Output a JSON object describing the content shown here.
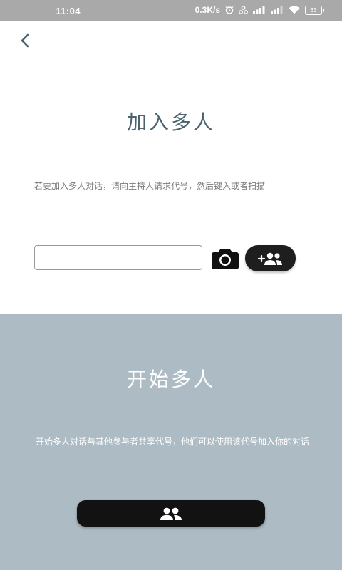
{
  "status_bar": {
    "time": "11:04",
    "network_speed": "0.3K/s",
    "battery": "63",
    "icons": [
      "alarm-icon",
      "share-icon",
      "signal-icon",
      "signal-icon",
      "wifi-icon",
      "battery-icon"
    ]
  },
  "header": {
    "back_icon": "chevron-left-icon"
  },
  "join": {
    "title": "加入多人",
    "description": "若要加入多人对话，请向主持人请求代号，然后键入或者扫描",
    "code_input_value": "",
    "code_input_placeholder": "",
    "camera_icon": "camera-icon",
    "join_icon": "add-group-icon"
  },
  "start": {
    "title": "开始多人",
    "description": "开始多人对话与其他参与者共享代号，他们可以使用该代号加入你的对话",
    "button_icon": "group-icon"
  },
  "colors": {
    "title_text": "#4a6470",
    "bottom_background": "#adbcc4",
    "button_background": "#1e1e1e",
    "status_bar": "#a9a9a9"
  }
}
